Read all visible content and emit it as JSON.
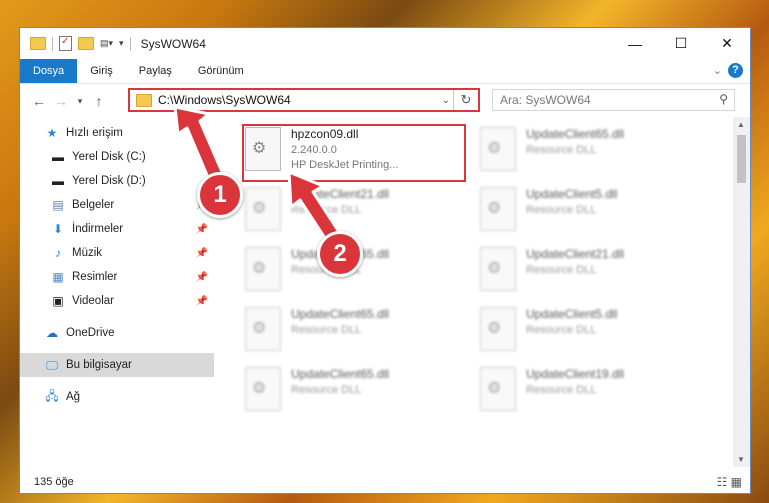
{
  "window": {
    "title": "SysWOW64",
    "controls": {
      "minimize": "—",
      "maximize": "☐",
      "close": "✕"
    }
  },
  "ribbon": {
    "tabs": [
      "Dosya",
      "Giriş",
      "Paylaş",
      "Görünüm"
    ],
    "active_tab": "Dosya",
    "help": "?"
  },
  "navigation": {
    "address_path": "C:\\Windows\\SysWOW64",
    "search_placeholder": "Ara: SysWOW64"
  },
  "sidebar": {
    "items": [
      {
        "label": "Hızlı erişim",
        "icon": "star-icon"
      },
      {
        "label": "Yerel Disk (C:)",
        "icon": "drive-icon"
      },
      {
        "label": "Yerel Disk (D:)",
        "icon": "drive-icon"
      },
      {
        "label": "Belgeler",
        "icon": "documents-icon"
      },
      {
        "label": "İndirmeler",
        "icon": "download-icon"
      },
      {
        "label": "Müzik",
        "icon": "music-icon"
      },
      {
        "label": "Resimler",
        "icon": "pictures-icon"
      },
      {
        "label": "Videolar",
        "icon": "video-icon"
      },
      {
        "label": "OneDrive",
        "icon": "cloud-icon"
      },
      {
        "label": "Bu bilgisayar",
        "icon": "computer-icon"
      },
      {
        "label": "Ağ",
        "icon": "network-icon"
      }
    ]
  },
  "files": [
    {
      "name": "hpzcon09.dll",
      "line2": "2.240.0.0",
      "line3": "HP DeskJet Printing..."
    },
    {
      "name": "UpdateClient65.dll",
      "line2": "Resource DLL"
    },
    {
      "name": "UpdateClient21.dll",
      "line2": "Resource DLL"
    },
    {
      "name": "UpdateClient5.dll",
      "line2": "Resource DLL"
    },
    {
      "name": "UpdateClient65.dll",
      "line2": "Resource DLL"
    },
    {
      "name": "UpdateClient21.dll",
      "line2": "Resource DLL"
    },
    {
      "name": "UpdateClient65.dll",
      "line2": "Resource DLL"
    },
    {
      "name": "UpdateClient5.dll",
      "line2": "Resource DLL"
    },
    {
      "name": "UpdateClient65.dll",
      "line2": "Resource DLL"
    },
    {
      "name": "UpdateClient19.dll",
      "line2": "Resource DLL"
    }
  ],
  "status": {
    "item_count": "135 öğe"
  },
  "annotations": {
    "badge1": "1",
    "badge2": "2",
    "color": "#d9353b"
  }
}
